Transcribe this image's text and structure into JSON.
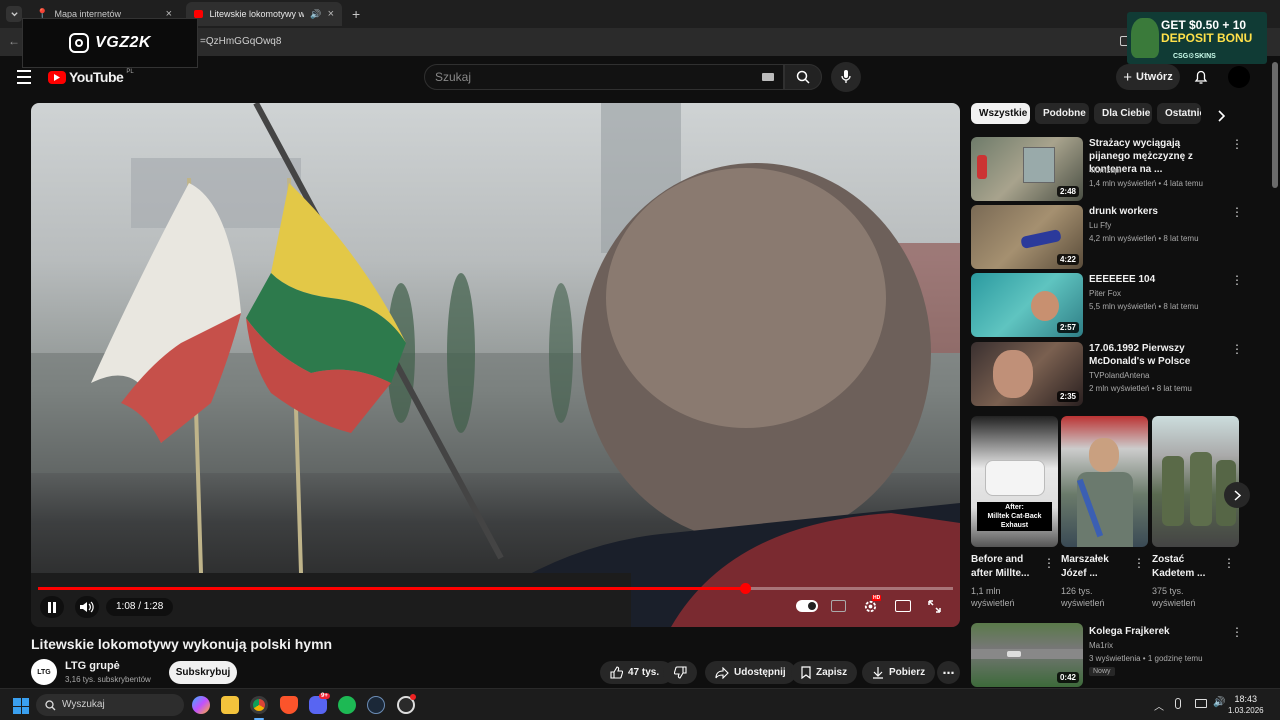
{
  "browser": {
    "tabs": [
      {
        "title": "Mapa internetów"
      },
      {
        "title": "Litewskie lokomotywy wyko"
      }
    ],
    "new_tab": "+",
    "close": "×",
    "url": "=QzHmGGqOwq8"
  },
  "overlay": {
    "logo_text": "VGZ2K"
  },
  "ad": {
    "line1": "GET $0.50 + 10",
    "line2": "DEPOSIT BONU",
    "brand": "CSG⚙SKINS"
  },
  "youtube": {
    "logo": "YouTube",
    "region": "PL",
    "search_placeholder": "Szukaj",
    "create_label": "Utwórz"
  },
  "player": {
    "time": "1:08 / 1:28",
    "progress": 0.773,
    "hd_badge": "HD"
  },
  "video": {
    "title": "Litewskie lokomotywy wykonują polski hymn",
    "channel": {
      "name": "LTG grupė",
      "subs": "3,16 tys. subskrybentów",
      "avatar_text": "LTG"
    },
    "subscribe_label": "Subskrybuj",
    "actions": {
      "likes": "47 tys.",
      "share": "Udostępnij",
      "save": "Zapisz",
      "download": "Pobierz"
    }
  },
  "chips": [
    "Wszystkie",
    "Podobne",
    "Dla Ciebie",
    "Ostatnio"
  ],
  "recommended": [
    {
      "title": "Strażacy wyciągają pijanego mężczyznę z kontenera na ...",
      "channel": "4lomzapl",
      "meta": "1,4 mln wyświetleń • 4 lata temu",
      "duration": "2:48"
    },
    {
      "title": "drunk workers",
      "channel": "Lu Ffy",
      "meta": "4,2 mln wyświetleń • 8 lat temu",
      "duration": "4:22"
    },
    {
      "title": "EEEEEEE 104",
      "channel": "Piter Fox",
      "meta": "5,5 mln wyświetleń • 8 lat temu",
      "duration": "2:57"
    },
    {
      "title": "17.06.1992 Pierwszy McDonald's w Polsce",
      "channel": "TVPolandAntena",
      "meta": "2 mln wyświetleń • 8 lat temu",
      "duration": "2:35"
    },
    {
      "title": "Kolega Frajkerek",
      "channel": "Ma1rix",
      "meta": "3 wyświetlenia • 1 godzinę temu",
      "duration": "0:42",
      "badge": "Nowy"
    }
  ],
  "shorts": [
    {
      "title": "Before and after Millte...",
      "views": "1,1 mln wyświetleń",
      "overlay": "After:\nMilltek Cat-Back\nExhaust"
    },
    {
      "title": "Marszałek Józef ...",
      "views": "126 tys. wyświetleń"
    },
    {
      "title": "Zostać Kadetem ...",
      "views": "375 tys. wyświetleń"
    }
  ],
  "taskbar": {
    "search": "Wyszukaj",
    "time": "18:43",
    "date": "1.03.2026",
    "discord_badge": "9+"
  },
  "colors": {
    "accent": "#ff0000",
    "bg": "#0f0f0f"
  }
}
